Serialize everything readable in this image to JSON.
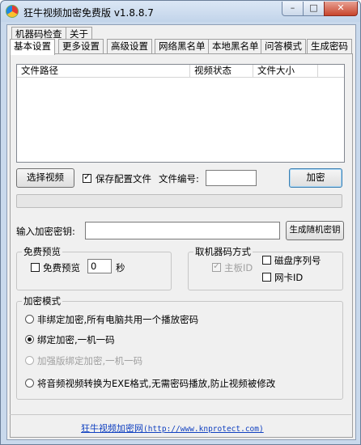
{
  "window": {
    "title": "狂牛视频加密免费版 v1.8.8.7",
    "controls": {
      "minimize": "–",
      "maximize": "□",
      "close": "✕"
    },
    "icon": "app-logo-icon"
  },
  "tabs": {
    "row1": [
      "机器码检查",
      "关于"
    ],
    "row2": [
      "基本设置",
      "更多设置",
      "高级设置",
      "网络黑名单",
      "本地黑名单",
      "问答模式",
      "生成密码"
    ],
    "active": "基本设置"
  },
  "filelist": {
    "columns": [
      "文件路径",
      "视频状态",
      "文件大小"
    ]
  },
  "actions": {
    "select_video": "选择视频",
    "save_config": "保存配置文件",
    "save_config_checked": true,
    "file_no_label": "文件编号:",
    "file_no_value": "",
    "encrypt": "加密"
  },
  "key": {
    "label": "输入加密密钥:",
    "value": "",
    "generate": "生成随机密钥"
  },
  "preview": {
    "title": "免费预览",
    "checkbox_label": "免费预览",
    "checked": false,
    "seconds_value": "0",
    "seconds_unit": "秒"
  },
  "machine_code": {
    "title": "取机器码方式",
    "mainboard": "主板ID",
    "mainboard_checked": true,
    "disk_serial": "磁盘序列号",
    "disk_checked": false,
    "nic": "网卡ID",
    "nic_checked": false
  },
  "encrypt_mode": {
    "title": "加密模式",
    "options": [
      "非绑定加密,所有电脑共用一个播放密码",
      "绑定加密,一机一码",
      "加强版绑定加密,一机一码",
      "将音频视频转换为EXE格式,无需密码播放,防止视频被修改"
    ],
    "selected": 1,
    "disabled": [
      2
    ]
  },
  "footer": {
    "link_text": "狂牛视频加密网",
    "url": "(http://www.knprotect.com)"
  }
}
